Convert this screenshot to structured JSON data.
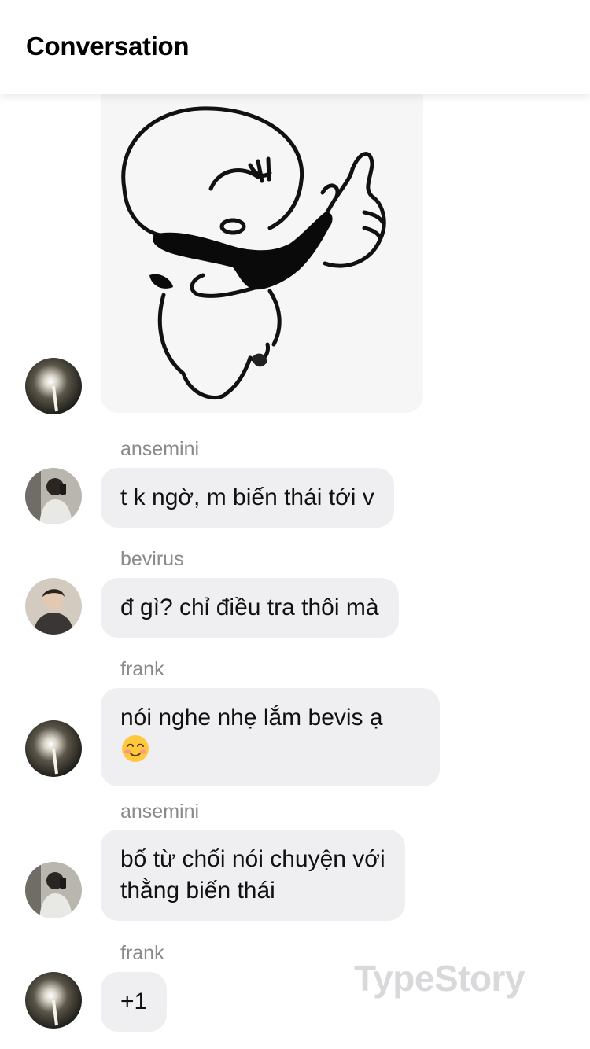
{
  "header": {
    "title": "Conversation"
  },
  "messages": [
    {
      "sender": "",
      "type": "sticker",
      "avatar": "avatar-light-photo",
      "icon": "thumbs-up-sunglasses-sticker"
    },
    {
      "sender": "ansemini",
      "text": "t k ngờ, m biến thái tới v",
      "avatar": "avatar-mirror-selfie"
    },
    {
      "sender": "bevirus",
      "text": "đ gì? chỉ điều tra thôi mà",
      "avatar": "avatar-portrait"
    },
    {
      "sender": "frank",
      "text": "nói nghe nhẹ lắm bevis ạ",
      "emoji": "smiling-face-icon",
      "avatar": "avatar-light-photo"
    },
    {
      "sender": "ansemini",
      "text_line1": "bố từ chối nói chuyện với",
      "text_line2": "thằng biến thái",
      "avatar": "avatar-mirror-selfie"
    },
    {
      "sender": "frank",
      "text": "+1",
      "avatar": "avatar-light-photo"
    }
  ],
  "watermark": "TypeStory",
  "colors": {
    "bubble": "#efeff2",
    "sender": "#8a8a8e",
    "background": "#ffffff"
  }
}
